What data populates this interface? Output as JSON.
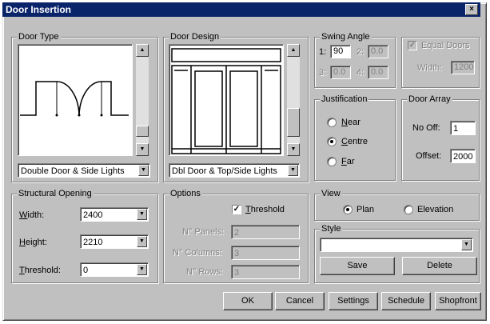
{
  "window": {
    "title": "Door Insertion",
    "close_glyph": "×"
  },
  "door_type": {
    "legend": "Door Type",
    "selected": "Double Door & Side Lights"
  },
  "door_design": {
    "legend": "Door Design",
    "selected": "Dbl Door & Top/Side Lights"
  },
  "swing_angle": {
    "legend": "Swing Angle",
    "labels": [
      "1:",
      "2:",
      "3:",
      "4:"
    ],
    "values": [
      "90",
      "0.0",
      "0.0",
      "0.0"
    ]
  },
  "equal_doors": {
    "label": "Equal Doors",
    "width_label": "Width:",
    "width_value": "1200"
  },
  "justification": {
    "legend": "Justification",
    "options": [
      {
        "key": "N",
        "rest": "ear"
      },
      {
        "key": "C",
        "rest": "entre"
      },
      {
        "key": "F",
        "rest": "ar"
      }
    ],
    "selected_index": 1
  },
  "door_array": {
    "legend": "Door Array",
    "no_off_label": "No Off:",
    "no_off_value": "1",
    "offset_label": "Offset:",
    "offset_value": "2000"
  },
  "structural_opening": {
    "legend": "Structural Opening",
    "width": {
      "key": "W",
      "rest": "idth:",
      "value": "2400"
    },
    "height": {
      "key": "H",
      "rest": "eight:",
      "value": "2210"
    },
    "threshold": {
      "key": "T",
      "rest": "hreshold:",
      "value": "0"
    }
  },
  "options": {
    "legend": "Options",
    "threshold": {
      "key": "T",
      "rest": "hreshold",
      "checked_glyph": "✓"
    },
    "panels": {
      "label": "N° Panels:",
      "value": "2"
    },
    "columns": {
      "label": "N° Columns:",
      "value": "3"
    },
    "rows": {
      "label": "N° Rows:",
      "value": "3"
    }
  },
  "view": {
    "legend": "View",
    "plan": "Plan",
    "elevation": "Elevation",
    "selected": "Plan"
  },
  "style": {
    "legend": "Style",
    "value": "",
    "save": "Save",
    "delete": "Delete"
  },
  "buttons": {
    "ok": "OK",
    "cancel": "Cancel",
    "settings": "Settings",
    "schedule": "Schedule",
    "shopfront": "Shopfront"
  },
  "glyphs": {
    "arrow_up": "▲",
    "arrow_down": "▼"
  }
}
